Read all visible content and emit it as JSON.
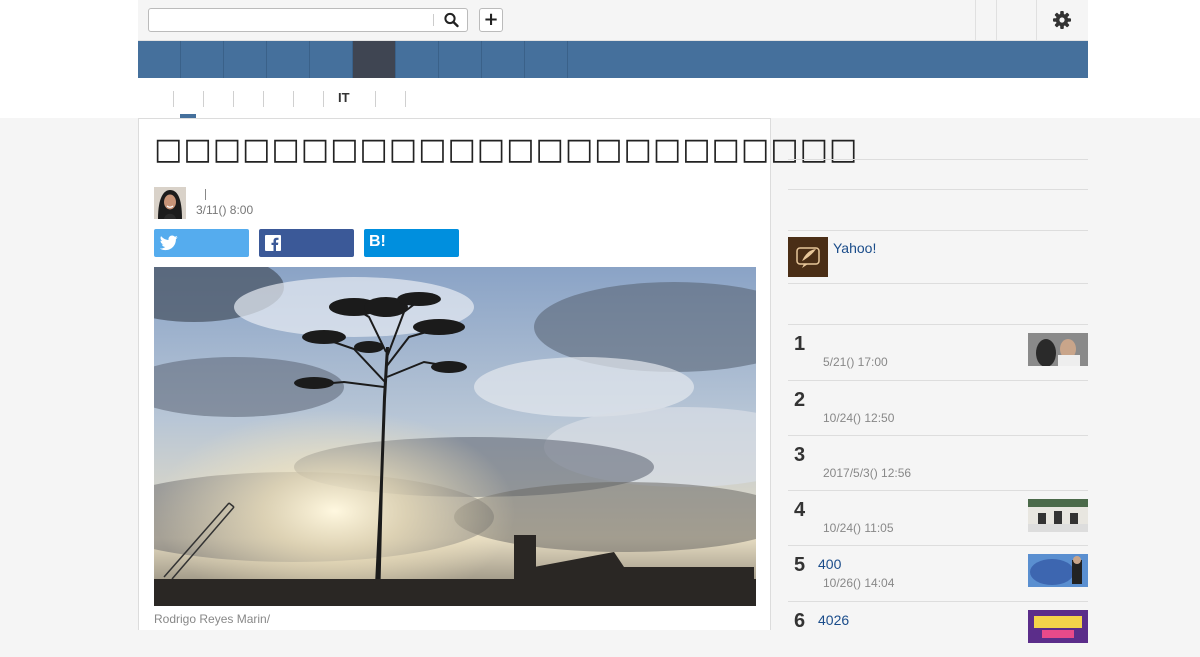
{
  "header": {
    "search_placeholder": "",
    "plus_label": "+"
  },
  "nav": {
    "tabs_count": 10,
    "active_index": 5
  },
  "subnav": {
    "items": [
      "",
      "",
      "",
      "",
      "",
      "IT",
      ""
    ],
    "active_index": 0
  },
  "article": {
    "title": "□□□□□□□□□□□□□□□□□□□□□□□□",
    "date": "3/11() 8:00",
    "caption": "Rodrigo Reyes Marin/",
    "share": {
      "twitter": "twitter-icon",
      "facebook": "facebook-icon",
      "hatena_label": "B!"
    }
  },
  "sidebar": {
    "promo_text": "Yahoo!",
    "ranking": [
      {
        "rank": "1",
        "title": "",
        "date": "5/21() 17:00",
        "has_thumb": true
      },
      {
        "rank": "2",
        "title": "",
        "date": "10/24() 12:50",
        "has_thumb": false
      },
      {
        "rank": "3",
        "title": "",
        "date": "2017/5/3() 12:56",
        "has_thumb": false
      },
      {
        "rank": "4",
        "title": "",
        "date": "10/24() 11:05",
        "has_thumb": true
      },
      {
        "rank": "5",
        "title": "400",
        "date": "10/26() 14:04",
        "has_thumb": true
      },
      {
        "rank": "6",
        "title": "4026",
        "date": "",
        "has_thumb": true
      }
    ]
  },
  "colors": {
    "nav_bg": "#45709c",
    "nav_active": "#3f4552",
    "twitter": "#55acee",
    "facebook": "#3b5998",
    "hatena": "#008fde",
    "link": "#1a4c8a"
  }
}
